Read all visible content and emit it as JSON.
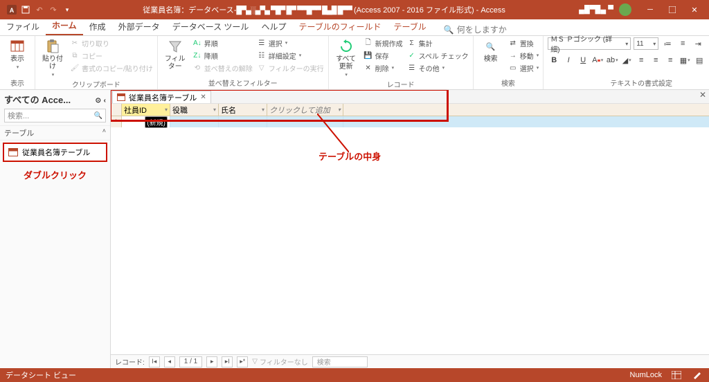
{
  "title": {
    "app_prefix": "従業員名簿：データベース-",
    "path_censored": "█▀▄░▄▀▄ ▀█▀ █▀  ▀▀█▀▀ █▄█ █▀▀",
    "format_suffix": "(Access 2007 - 2016 ファイル形式)  -  Access",
    "user_name": "▄█▀█▄ ▀"
  },
  "tabs": {
    "file": "ファイル",
    "home": "ホーム",
    "create": "作成",
    "external": "外部データ",
    "dbtools": "データベース ツール",
    "help": "ヘルプ",
    "ctx_fields": "テーブルのフィールド",
    "ctx_table": "テーブル",
    "tell_me": "何をしますか"
  },
  "ribbon": {
    "views": {
      "label": "表示",
      "btn": "表示"
    },
    "clipboard": {
      "label": "クリップボード",
      "paste": "貼り付け",
      "cut": "切り取り",
      "copy": "コピー",
      "fmtpainter": "書式のコピー/貼り付け"
    },
    "sortfilter": {
      "label": "並べ替えとフィルター",
      "filter": "フィルター",
      "asc": "昇順",
      "desc": "降順",
      "clear_sort": "並べ替えの解除",
      "selection": "選択",
      "advanced": "詳細設定",
      "toggle": "フィルターの実行"
    },
    "records": {
      "label": "レコード",
      "refresh": "すべて\n更新",
      "new": "新規作成",
      "save": "保存",
      "delete": "削除",
      "totals": "集計",
      "spell": "スペル チェック",
      "more": "その他"
    },
    "find": {
      "label": "検索",
      "find": "検索",
      "replace": "置換",
      "goto": "移動",
      "select": "選択"
    },
    "textfmt": {
      "label": "テキストの書式設定",
      "font": "ＭＳ Ｐゴシック (詳細)",
      "size": "11"
    }
  },
  "nav": {
    "header": "すべての Acce...",
    "search": "検索...",
    "section": "テーブル",
    "item": "従業員名簿テーブル"
  },
  "document": {
    "tab_name": "従業員名簿テーブル",
    "columns": [
      "社員ID",
      "役職",
      "氏名"
    ],
    "add_col": "クリックして追加",
    "new_marker": "(新規)"
  },
  "record_nav": {
    "label": "レコード:",
    "pos": "1 / 1",
    "filter_none": "フィルターなし",
    "search": "検索"
  },
  "status": {
    "left": "データシート ビュー",
    "numlock": "NumLock"
  },
  "annotations": {
    "double_click": "ダブルクリック",
    "table_body": "テーブルの中身"
  }
}
